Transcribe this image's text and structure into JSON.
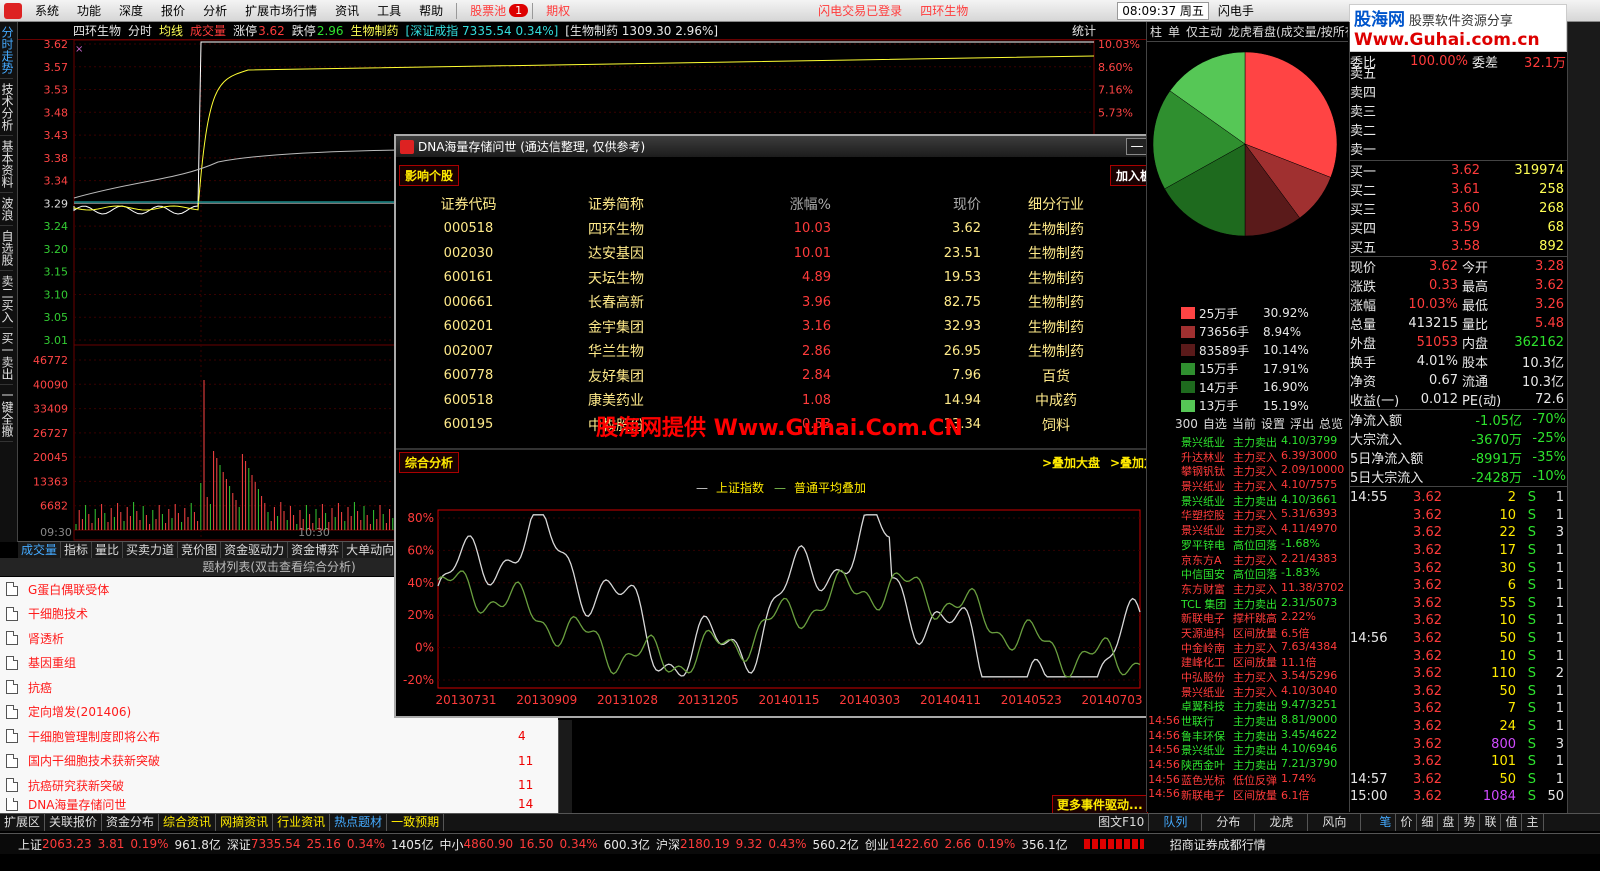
{
  "menu": {
    "items": [
      "系统",
      "功能",
      "深度",
      "报价",
      "分析",
      "扩展市场行情",
      "资讯",
      "工具",
      "帮助"
    ],
    "pool": "股票池",
    "pool_badge": "1",
    "options": "期权",
    "status_text": "闪电交易已登录",
    "stock_name": "四环生物",
    "clock": "08:09:37 周五",
    "quick": "闪电手"
  },
  "logo": {
    "line1": "股海网",
    "line2": "股票软件资源分享",
    "url": "Www.Guhai.com.cn"
  },
  "vtabs": [
    "分时走势",
    "技术分析",
    "基本资料",
    "波浪",
    "自选股",
    "卖二买入",
    "买一卖出",
    "一键全撤"
  ],
  "chart_header": {
    "name": "四环生物",
    "mode": "分时",
    "avg": "均线",
    "vol": "成交量",
    "change_label": "涨停",
    "price": "3.62",
    "down_label": "跌停",
    "down_price": "2.96",
    "sector": "生物制药",
    "index": "[深证成指 7335.54 0.34%]",
    "sector_idx": "[生物制药 1309.30 2.96%]",
    "stats": "统计",
    "x_mark": "×"
  },
  "chart_data": [
    {
      "type": "line",
      "y_ticks_left": [
        "3.62",
        "3.57",
        "3.53",
        "3.48",
        "3.43",
        "3.38",
        "3.34",
        "3.29",
        "3.24",
        "3.20",
        "3.15",
        "3.10",
        "3.05",
        "3.01"
      ],
      "y_ticks_right": [
        "10.03%",
        "8.60%",
        "7.16%",
        "5.73%"
      ],
      "vol_ticks": [
        "46772",
        "40090",
        "33409",
        "26727",
        "20045",
        "13363",
        "6682"
      ],
      "x_ticks": [
        "09:30",
        "10:30"
      ]
    },
    {
      "type": "pie",
      "slices": [
        {
          "label": "25万手",
          "pct": 30.92,
          "color": "#ff4444"
        },
        {
          "label": "73656手",
          "pct": 8.94,
          "color": "#a03030"
        },
        {
          "label": "83589手",
          "pct": 10.14,
          "color": "#5a1a1a"
        },
        {
          "label": "15万手",
          "pct": 17.91,
          "color": "#2f8f2f"
        },
        {
          "label": "14万手",
          "pct": 16.9,
          "color": "#1e6a1e"
        },
        {
          "label": "13万手",
          "pct": 15.19,
          "color": "#56c756"
        }
      ]
    },
    {
      "type": "line",
      "legend": [
        "上证指数",
        "普通平均叠加"
      ],
      "y_ticks": [
        "80%",
        "60%",
        "40%",
        "20%",
        "0%",
        "-20%"
      ],
      "ylim": [
        -20,
        80
      ],
      "x": [
        "20130731",
        "20130909",
        "20131028",
        "20131205",
        "20140115",
        "20140303",
        "20140411",
        "20140523",
        "20140703"
      ]
    }
  ],
  "bottom_tabs": [
    "成交量",
    "指标",
    "量比",
    "买卖力道",
    "竞价图",
    "资金驱动力",
    "资金博弈",
    "大单动向"
  ],
  "topic_title": "题材列表(双击查看综合分析)",
  "topics": [
    {
      "name": "G蛋白偶联受体",
      "num": ""
    },
    {
      "name": "干细胞技术",
      "num": ""
    },
    {
      "name": "肾透析",
      "num": ""
    },
    {
      "name": "基因重组",
      "num": ""
    },
    {
      "name": "抗癌",
      "num": ""
    },
    {
      "name": "定向增发(201406)",
      "num": ""
    },
    {
      "name": "干细胞管理制度即将公布",
      "num": "4"
    },
    {
      "name": "国内干细胞技术获新突破",
      "num": "11"
    },
    {
      "name": "抗癌研究获新突破",
      "num": "11"
    },
    {
      "name": "DNA海量存储问世",
      "num": "14"
    }
  ],
  "dialog": {
    "title": "DNA海量存储问世 (通达信整理, 仅供参考)",
    "minimize": "—",
    "close": "✕",
    "section1": "影响个股",
    "add_block": "加入板块",
    "headers": [
      "证券代码",
      "证券简称",
      "涨幅%",
      "现价",
      "细分行业"
    ],
    "rows": [
      [
        "000518",
        "四环生物",
        "10.03",
        "3.62",
        "生物制药"
      ],
      [
        "002030",
        "达安基因",
        "10.01",
        "23.51",
        "生物制药"
      ],
      [
        "600161",
        "天坛生物",
        "4.89",
        "19.53",
        "生物制药"
      ],
      [
        "000661",
        "长春高新",
        "3.96",
        "82.75",
        "生物制药"
      ],
      [
        "600201",
        "金宇集团",
        "3.16",
        "32.93",
        "生物制药"
      ],
      [
        "002007",
        "华兰生物",
        "2.86",
        "26.95",
        "生物制药"
      ],
      [
        "600778",
        "友好集团",
        "2.84",
        "7.96",
        "百货"
      ],
      [
        "600518",
        "康美药业",
        "1.08",
        "14.94",
        "中成药"
      ],
      [
        "600195",
        "中牧股份",
        "0.53",
        "13.34",
        "饲料"
      ]
    ],
    "watermark": "股海网提供 Www.Guhai.Com.CN",
    "section2": "综合分析",
    "overlay_market": ">叠加大盘",
    "overlay_mode": ">叠加方式",
    "more_events": "更多事件驱动..."
  },
  "mid_header": [
    "柱",
    "单",
    "仅主动",
    "龙虎看盘(成交量/按所有)"
  ],
  "mid_tabs": [
    "300",
    "自选",
    "当前",
    "设置",
    "浮出",
    "总览"
  ],
  "news": [
    [
      "景兴纸业",
      "主力卖出",
      "4.10/3799"
    ],
    [
      "升达林业",
      "主力买入",
      "6.39/3000"
    ],
    [
      "攀钢钒钛",
      "主力买入",
      "2.09/10000"
    ],
    [
      "景兴纸业",
      "主力买入",
      "4.10/7575"
    ],
    [
      "景兴纸业",
      "主力卖出",
      "4.10/3661"
    ],
    [
      "华塑控股",
      "主力买入",
      "5.31/6393"
    ],
    [
      "景兴纸业",
      "主力买入",
      "4.11/4970"
    ],
    [
      "罗平锌电",
      "高位回落",
      "-1.68%"
    ],
    [
      "京东方A",
      "主力买入",
      "2.21/4383"
    ],
    [
      "中信国安",
      "高位回落",
      "-1.83%"
    ],
    [
      "东方财富",
      "主力买入",
      "11.38/3702"
    ],
    [
      "TCL 集团",
      "主力卖出",
      "2.31/5073"
    ],
    [
      "新联电子",
      "撑杆跳高",
      "2.22%"
    ],
    [
      "天源迪科",
      "区间放量",
      "6.5倍"
    ],
    [
      "中金岭南",
      "主力买入",
      "7.63/4384"
    ],
    [
      "建峰化工",
      "区间放量",
      "11.1倍"
    ],
    [
      "中弘股份",
      "主力买入",
      "3.54/5296"
    ],
    [
      "景兴纸业",
      "主力买入",
      "4.10/3040"
    ],
    [
      "卓翼科技",
      "主力卖出",
      "9.47/3251"
    ],
    [
      "世联行",
      "主力卖出",
      "8.81/9000"
    ],
    [
      "鲁丰环保",
      "主力卖出",
      "3.45/4622"
    ],
    [
      "景兴纸业",
      "主力卖出",
      "4.10/6946"
    ],
    [
      "陕西金叶",
      "主力卖出",
      "7.21/3790"
    ],
    [
      "蓝色光标",
      "低位反弹",
      "1.74%"
    ],
    [
      "新联电子",
      "区间放量",
      "6.1倍"
    ]
  ],
  "news_time": "14:56",
  "quote": {
    "ratio_label": "委比",
    "ratio": "100.00%",
    "diff_label": "委差",
    "diff": "32.1万",
    "sells": [
      "卖五",
      "卖四",
      "卖三",
      "卖二",
      "卖一"
    ],
    "buys": [
      [
        "买一",
        "3.62",
        "319974"
      ],
      [
        "买二",
        "3.61",
        "258"
      ],
      [
        "买三",
        "3.60",
        "268"
      ],
      [
        "买四",
        "3.59",
        "68"
      ],
      [
        "买五",
        "3.58",
        "892"
      ]
    ],
    "stats": [
      [
        "现价",
        "3.62",
        "今开",
        "3.28"
      ],
      [
        "涨跌",
        "0.33",
        "最高",
        "3.62"
      ],
      [
        "涨幅",
        "10.03%",
        "最低",
        "3.26"
      ],
      [
        "总量",
        "413215",
        "量比",
        "5.48"
      ],
      [
        "外盘",
        "51053",
        "内盘",
        "362162"
      ],
      [
        "换手",
        "4.01%",
        "股本",
        "10.3亿"
      ],
      [
        "净资",
        "0.67",
        "流通",
        "10.3亿"
      ],
      [
        "收益(一)",
        "0.012",
        "PE(动)",
        "72.6"
      ]
    ],
    "flows": [
      [
        "净流入额",
        "-1.05亿",
        "-70%"
      ],
      [
        "大宗流入",
        "-3670万",
        "-25%"
      ],
      [
        "5日净流入额",
        "-8991万",
        "-35%"
      ],
      [
        "5日大宗流入",
        "-2428万",
        "-10%"
      ]
    ],
    "ticks": [
      [
        "14:55",
        "3.62",
        "2",
        "S",
        "1"
      ],
      [
        "",
        "3.62",
        "10",
        "S",
        "1"
      ],
      [
        "",
        "3.62",
        "22",
        "S",
        "3"
      ],
      [
        "",
        "3.62",
        "17",
        "S",
        "1"
      ],
      [
        "",
        "3.62",
        "30",
        "S",
        "1"
      ],
      [
        "",
        "3.62",
        "6",
        "S",
        "1"
      ],
      [
        "",
        "3.62",
        "55",
        "S",
        "1"
      ],
      [
        "",
        "3.62",
        "10",
        "S",
        "1"
      ],
      [
        "14:56",
        "3.62",
        "50",
        "S",
        "1"
      ],
      [
        "",
        "3.62",
        "10",
        "S",
        "1"
      ],
      [
        "",
        "3.62",
        "110",
        "S",
        "2"
      ],
      [
        "",
        "3.62",
        "50",
        "S",
        "1"
      ],
      [
        "",
        "3.62",
        "7",
        "S",
        "1"
      ],
      [
        "",
        "3.62",
        "24",
        "S",
        "1"
      ],
      [
        "",
        "3.62",
        "800",
        "S",
        "3"
      ],
      [
        "",
        "3.62",
        "101",
        "S",
        "1"
      ],
      [
        "14:57",
        "3.62",
        "50",
        "S",
        "1"
      ],
      [
        "15:00",
        "3.62",
        "1084",
        "S",
        "50"
      ]
    ]
  },
  "footer_tabs": [
    "扩展区",
    "关联报价",
    "资金分布",
    "综合资讯",
    "网摘资讯",
    "行业资讯",
    "热点题材",
    "一致预期"
  ],
  "footer_right": [
    "图文F10",
    "队列",
    "分布",
    "龙虎",
    "风向"
  ],
  "footer_far": [
    "笔",
    "价",
    "细",
    "盘",
    "势",
    "联",
    "值",
    "主"
  ],
  "status": {
    "sh": "上证",
    "sh_v": "2063.23",
    "sh_c": "3.81",
    "sh_p": "0.19%",
    "sh_a": "961.8亿",
    "sz": "深证",
    "sz_v": "7335.54",
    "sz_c": "25.16",
    "sz_p": "0.34%",
    "sz_a": "1405亿",
    "zx": "中小",
    "zx_v": "4860.90",
    "zx_c": "16.50",
    "zx_p": "0.34%",
    "zx_a": "600.3亿",
    "hs": "沪深",
    "hs_v": "2180.19",
    "hs_c": "9.32",
    "hs_p": "0.43%",
    "hs_a": "560.2亿",
    "cy": "创业",
    "cy_v": "1422.60",
    "cy_c": "2.66",
    "cy_p": "0.19%",
    "cy_a": "356.1亿",
    "broker": "招商证券成都行情"
  }
}
